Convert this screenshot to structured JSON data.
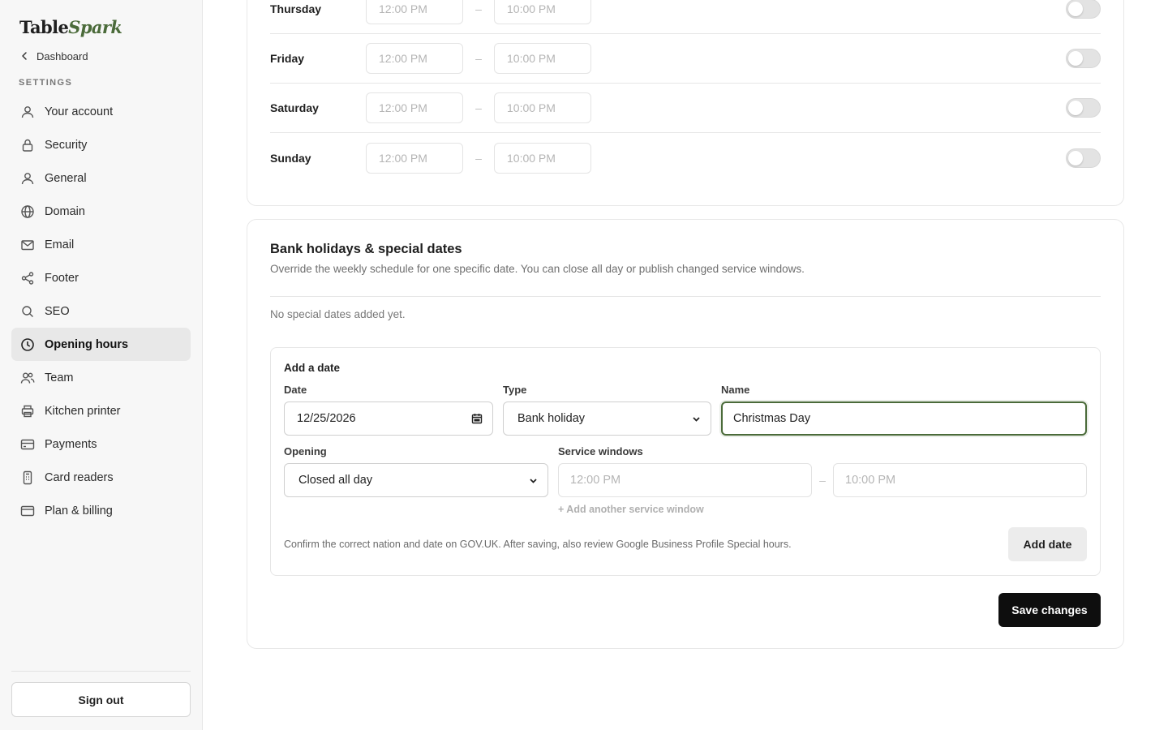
{
  "brand": {
    "name_plain": "Table",
    "name_accent": "Spark",
    "accent_color": "#4b6b3a"
  },
  "sidebar": {
    "back_label": "Dashboard",
    "section_label": "SETTINGS",
    "items": [
      {
        "label": "Your account",
        "icon": "user-icon"
      },
      {
        "label": "Security",
        "icon": "lock-icon"
      },
      {
        "label": "General",
        "icon": "user-icon"
      },
      {
        "label": "Domain",
        "icon": "globe-icon"
      },
      {
        "label": "Email",
        "icon": "mail-icon"
      },
      {
        "label": "Footer",
        "icon": "share-icon"
      },
      {
        "label": "SEO",
        "icon": "search-icon"
      },
      {
        "label": "Opening hours",
        "icon": "clock-icon",
        "active": true
      },
      {
        "label": "Team",
        "icon": "users-icon"
      },
      {
        "label": "Kitchen printer",
        "icon": "printer-icon"
      },
      {
        "label": "Payments",
        "icon": "credit-card-icon"
      },
      {
        "label": "Card readers",
        "icon": "card-reader-icon"
      },
      {
        "label": "Plan & billing",
        "icon": "billing-card-icon"
      }
    ],
    "sign_out_label": "Sign out"
  },
  "weekly": {
    "days": [
      {
        "name": "Thursday",
        "open": "12:00 PM",
        "close": "10:00 PM",
        "enabled": false
      },
      {
        "name": "Friday",
        "open": "12:00 PM",
        "close": "10:00 PM",
        "enabled": false
      },
      {
        "name": "Saturday",
        "open": "12:00 PM",
        "close": "10:00 PM",
        "enabled": false
      },
      {
        "name": "Sunday",
        "open": "12:00 PM",
        "close": "10:00 PM",
        "enabled": false
      }
    ],
    "separator": "–"
  },
  "special": {
    "title": "Bank holidays & special dates",
    "description": "Override the weekly schedule for one specific date. You can close all day or publish changed service windows.",
    "empty_text": "No special dates added yet.",
    "form": {
      "title": "Add a date",
      "date_label": "Date",
      "date_value": "12/25/2026",
      "type_label": "Type",
      "type_value": "Bank holiday",
      "name_label": "Name",
      "name_value": "Christmas Day",
      "opening_label": "Opening",
      "opening_value": "Closed all day",
      "windows_label": "Service windows",
      "window_start": "12:00 PM",
      "window_end": "10:00 PM",
      "window_separator": "–",
      "add_window_label": "+ Add another service window",
      "note": "Confirm the correct nation and date on GOV.UK. After saving, also review Google Business Profile Special hours.",
      "add_button": "Add date"
    },
    "save_button": "Save changes"
  }
}
